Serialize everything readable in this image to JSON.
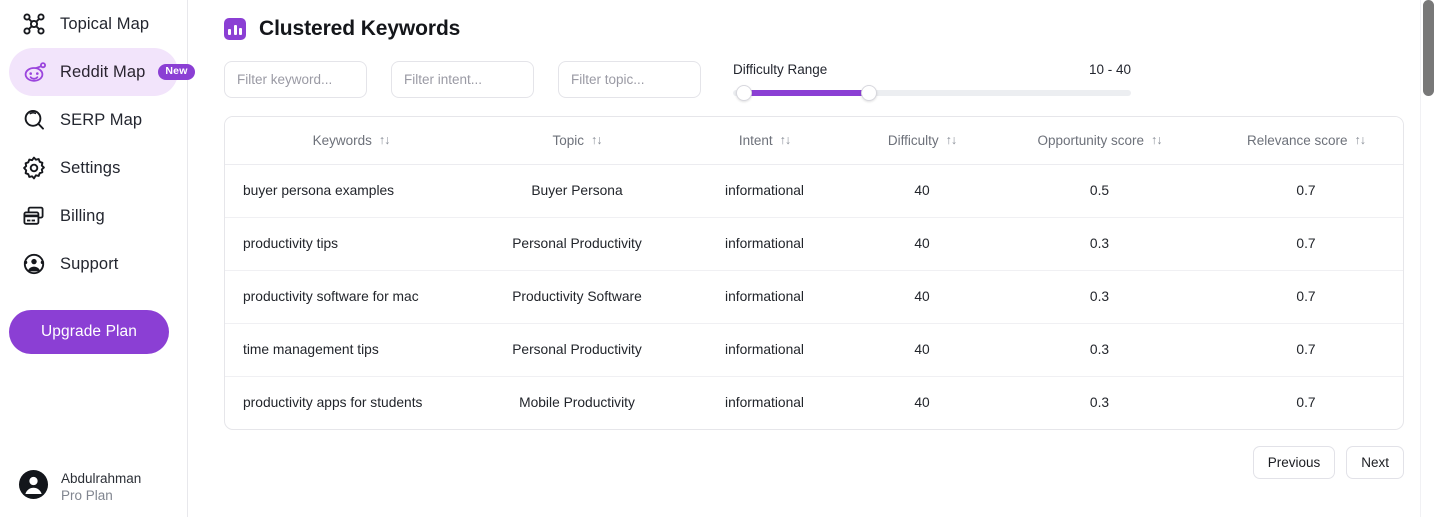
{
  "sidebar": {
    "items": [
      {
        "label": "Topical Map",
        "icon": "network-graph-icon",
        "active": false,
        "badge": null
      },
      {
        "label": "Reddit Map",
        "icon": "reddit-icon",
        "active": true,
        "badge": "New"
      },
      {
        "label": "SERP Map",
        "icon": "search-icon",
        "active": false,
        "badge": null
      },
      {
        "label": "Settings",
        "icon": "gear-icon",
        "active": false,
        "badge": null
      },
      {
        "label": "Billing",
        "icon": "credit-card-icon",
        "active": false,
        "badge": null
      },
      {
        "label": "Support",
        "icon": "support-agent-icon",
        "active": false,
        "badge": null
      }
    ],
    "upgrade_label": "Upgrade Plan",
    "user": {
      "name": "Abdulrahman",
      "plan": "Pro Plan",
      "avatar_icon": "user-avatar-icon"
    }
  },
  "header": {
    "title": "Clustered Keywords",
    "icon": "bar-chart-icon"
  },
  "filters": [
    {
      "name": "keyword",
      "placeholder": "Filter keyword...",
      "value": ""
    },
    {
      "name": "intent",
      "placeholder": "Filter intent...",
      "value": ""
    },
    {
      "name": "topic",
      "placeholder": "Filter topic...",
      "value": ""
    }
  ],
  "difficulty_slider": {
    "label": "Difficulty Range",
    "value_text": "10 - 40",
    "min_value": 10,
    "max_value": 40
  },
  "table": {
    "columns": [
      {
        "label": "Keywords",
        "sort_icon": "sort-arrows-icon"
      },
      {
        "label": "Topic",
        "sort_icon": "sort-arrows-icon"
      },
      {
        "label": "Intent",
        "sort_icon": "sort-arrows-icon"
      },
      {
        "label": "Difficulty",
        "sort_icon": "sort-arrows-icon"
      },
      {
        "label": "Opportunity score",
        "sort_icon": "sort-arrows-icon"
      },
      {
        "label": "Relevance score",
        "sort_icon": "sort-arrows-icon"
      }
    ],
    "rows": [
      {
        "keyword": "buyer persona examples",
        "topic": "Buyer Persona",
        "intent": "informational",
        "difficulty": "40",
        "opportunity": "0.5",
        "relevance": "0.7"
      },
      {
        "keyword": "productivity tips",
        "topic": "Personal Productivity",
        "intent": "informational",
        "difficulty": "40",
        "opportunity": "0.3",
        "relevance": "0.7"
      },
      {
        "keyword": "productivity software for mac",
        "topic": "Productivity Software",
        "intent": "informational",
        "difficulty": "40",
        "opportunity": "0.3",
        "relevance": "0.7"
      },
      {
        "keyword": "time management tips",
        "topic": "Personal Productivity",
        "intent": "informational",
        "difficulty": "40",
        "opportunity": "0.3",
        "relevance": "0.7"
      },
      {
        "keyword": "productivity apps for students",
        "topic": "Mobile Productivity",
        "intent": "informational",
        "difficulty": "40",
        "opportunity": "0.3",
        "relevance": "0.7"
      }
    ]
  },
  "pagination": {
    "previous_label": "Previous",
    "next_label": "Next"
  },
  "colors": {
    "accent": "#8b3fd4",
    "active_bg": "#f2e4fb",
    "text": "#23262f",
    "muted": "#6d717a"
  }
}
